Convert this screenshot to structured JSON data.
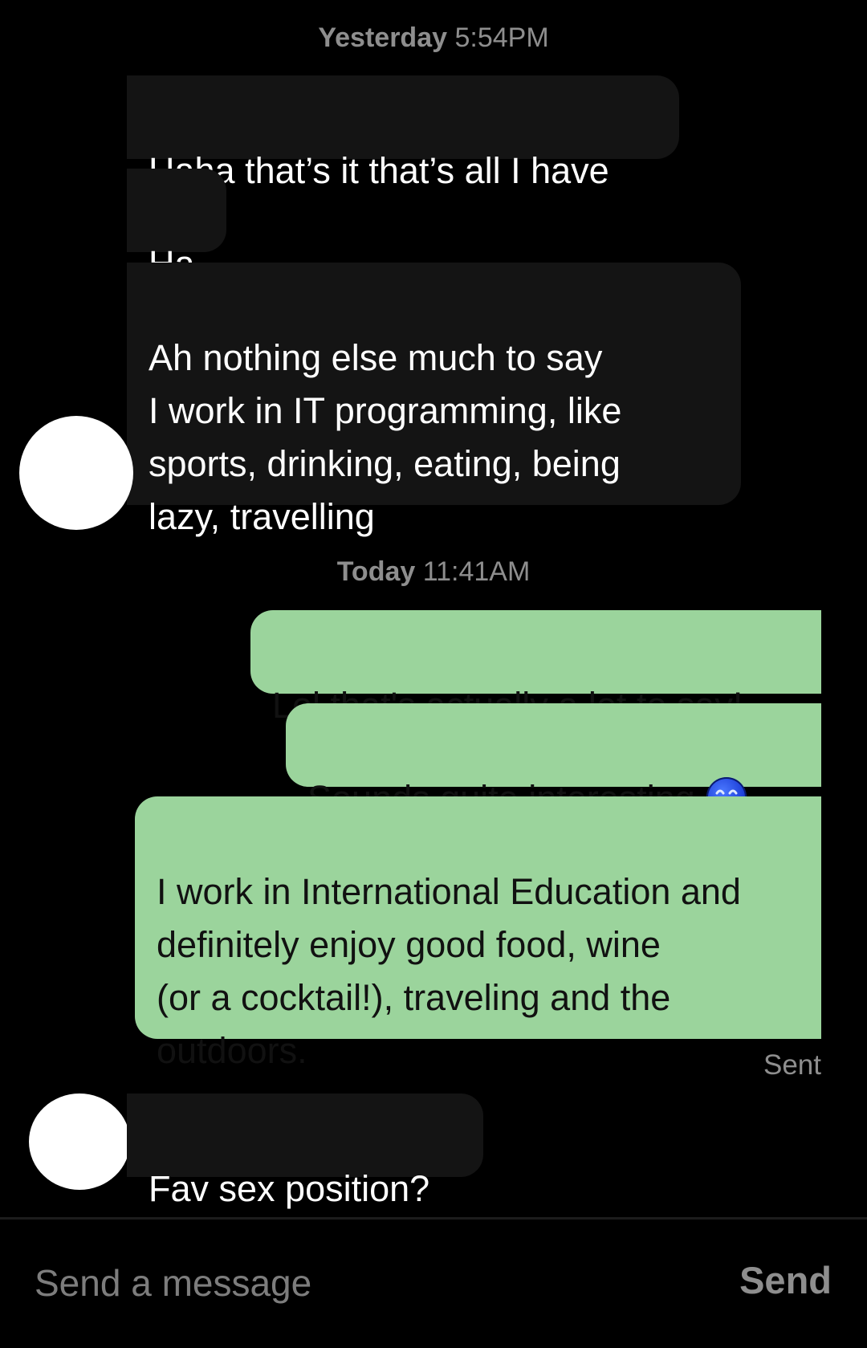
{
  "thread": {
    "separators": [
      {
        "day": "Yesterday",
        "time": "5:54PM"
      },
      {
        "day": "Today",
        "time": "11:41AM"
      }
    ],
    "messages": [
      {
        "from": "them",
        "text": "Haha that’s it that’s all I have"
      },
      {
        "from": "them",
        "text": "Ha"
      },
      {
        "from": "them",
        "text": "Ah nothing else much to say\nI work in IT programming, like\nsports, drinking, eating, being\nlazy, travelling"
      },
      {
        "from": "me",
        "text": "Lol that's actually a lot to say!"
      },
      {
        "from": "me",
        "text": "Sounds quite interesting",
        "emoji": "smiling-face-emoji"
      },
      {
        "from": "me",
        "text": "I work in International Education and\ndefinitely enjoy good food, wine\n(or a cocktail!), traveling and the\noutdoors."
      },
      {
        "from": "them",
        "text": "Fav sex position?"
      }
    ],
    "status": "Sent"
  },
  "composer": {
    "placeholder": "Send a message",
    "send_label": "Send"
  },
  "colors": {
    "background": "#000000",
    "received_bubble": "#141414",
    "sent_bubble": "#9bd49c",
    "timestamp_text": "#8e8e8e"
  }
}
